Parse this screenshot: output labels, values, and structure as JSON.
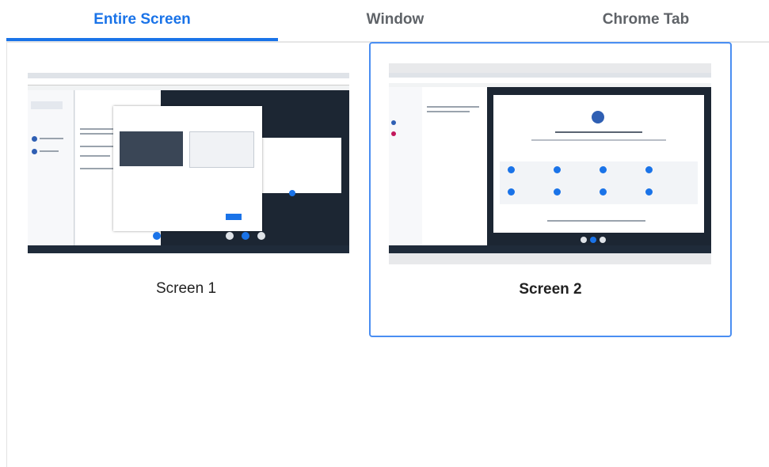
{
  "tabs": [
    {
      "label": "Entire Screen",
      "active": true
    },
    {
      "label": "Window",
      "active": false
    },
    {
      "label": "Chrome Tab",
      "active": false
    }
  ],
  "sources": [
    {
      "label": "Screen 1",
      "selected": false
    },
    {
      "label": "Screen 2",
      "selected": true
    }
  ],
  "colors": {
    "accent": "#1a73e8",
    "selection_border": "#4a8ef2",
    "tab_inactive": "#5f6368"
  }
}
